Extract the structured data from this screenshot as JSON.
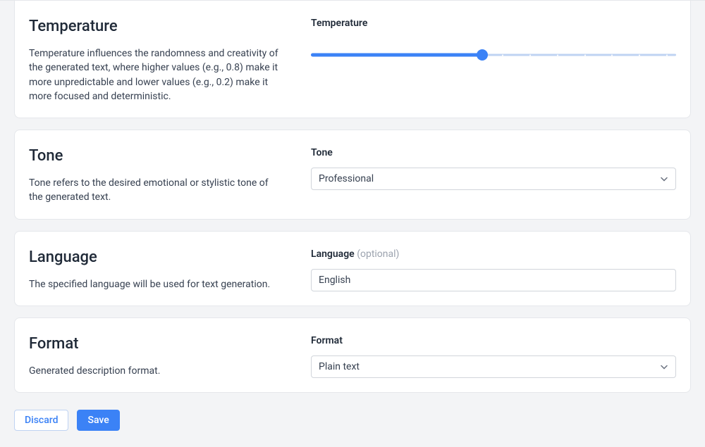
{
  "temperature": {
    "title": "Temperature",
    "description": "Temperature influences the randomness and creativity of the generated text, where higher values (e.g., 0.8) make it more unpredictable and lower values (e.g., 0.2) make it more focused and deterministic.",
    "field_label": "Temperature",
    "slider_percent": 47
  },
  "tone": {
    "title": "Tone",
    "description": "Tone refers to the desired emotional or stylistic tone of the generated text.",
    "field_label": "Tone",
    "selected": "Professional"
  },
  "language": {
    "title": "Language",
    "description": "The specified language will be used for text generation.",
    "field_label": "Language",
    "optional_label": "(optional)",
    "value": "English"
  },
  "format": {
    "title": "Format",
    "description": "Generated description format.",
    "field_label": "Format",
    "selected": "Plain text"
  },
  "actions": {
    "discard": "Discard",
    "save": "Save"
  }
}
